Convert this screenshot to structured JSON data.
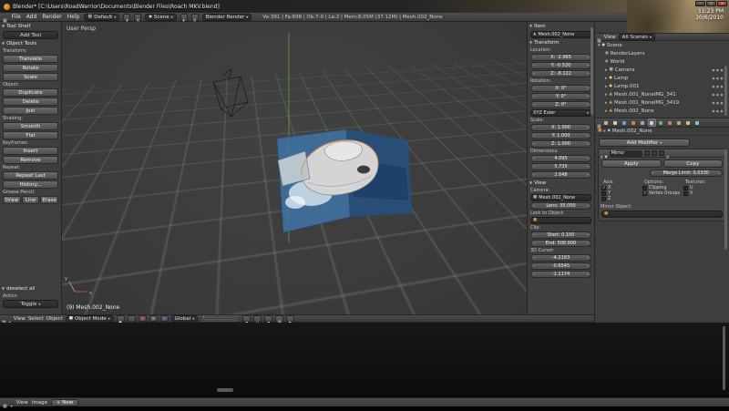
{
  "titlebar": {
    "title": "Blender* [C:\\Users\\RoadWarrior\\Documents\\Blender Files\\Roach MKV.blend]",
    "clock_time": "11:23 PM",
    "clock_date": "10/6/2010",
    "buttons": {
      "minimize": "–",
      "maximize": "□",
      "close": "×"
    }
  },
  "infobar": {
    "menus": [
      "File",
      "Add",
      "Render",
      "Help"
    ],
    "layout_value": "Default",
    "scene_value": "Scene",
    "engine_value": "Blender Render",
    "stats": "Ve:391 | Fa:698 | Ob:7-0 | La:2 | Mem:8.05M (37.12M) | Mesh.002_None"
  },
  "tool_shelf": {
    "title": "Tool Shelf",
    "add_tool_label": "Add Tool",
    "panel_title": "Object Tools",
    "groups": [
      {
        "label": "Transform:",
        "buttons": [
          "Translate",
          "Rotate",
          "Scale"
        ]
      },
      {
        "label": "Object:",
        "buttons": [
          "Duplicate",
          "Delete",
          "Join"
        ]
      },
      {
        "label": "Shading:",
        "buttons": [
          "Smooth",
          "Flat"
        ]
      },
      {
        "label": "Keyframes:",
        "buttons": [
          "Insert",
          "Remove"
        ]
      },
      {
        "label": "Repeat:",
        "buttons": [
          "Repeat Last",
          "History..."
        ]
      },
      {
        "label": "Grease Pencil:",
        "buttons": [
          "Draw",
          "Line",
          "Erase"
        ]
      }
    ],
    "operator_panel": "deselect all",
    "action_label": "Action",
    "action_value": "Toggle"
  },
  "viewport": {
    "view_label": "User Persp",
    "object_label": "(9) Mesh.002_None",
    "axis_x": "x",
    "axis_y": "y"
  },
  "n_panel": {
    "item_header": "Item",
    "item_name": "Mesh.002_None",
    "transform_header": "Transform",
    "location_label": "Location:",
    "location_x": "X: -2.965",
    "location_y": "Y: -0.520",
    "location_z": "Z: -8.122",
    "rotation_label": "Rotation:",
    "rotation_x": "X: 0°",
    "rotation_y": "Y: 0°",
    "rotation_z": "Z: 0°",
    "rotation_mode": "XYZ Euler",
    "scale_label": "Scale:",
    "scale_x": "X: 1.000",
    "scale_y": "Y: 1.000",
    "scale_z": "Z: 1.000",
    "dimensions_label": "Dimensions:",
    "dim_x": "4.095",
    "dim_y": "5.735",
    "dim_z": "2.048",
    "view_header": "View",
    "camera_label": "Camera:",
    "camera_value": "Mesh.002_None",
    "lens_value": "Lens: 35.000",
    "lock_label": "Lock to Object:",
    "clip_label": "Clip:",
    "clip_start": "Start: 0.100",
    "clip_end": "End: 500.000",
    "cursor_label": "3D Cursor:",
    "cursor_x": "-4.2193",
    "cursor_y": "-0.6545",
    "cursor_z": "-1.1174"
  },
  "outliner": {
    "view_menu": "View",
    "scenes_filter": "All Scenes",
    "rows": [
      {
        "label": "Scene",
        "icon": "scene-icon"
      },
      {
        "label": "RenderLayers",
        "icon": "renderlayers-icon"
      },
      {
        "label": "World",
        "icon": "world-icon"
      },
      {
        "label": "Camera",
        "icon": "camera-icon"
      },
      {
        "label": "Lamp",
        "icon": "lamp-icon"
      },
      {
        "label": "Lamp.001",
        "icon": "lamp-icon"
      },
      {
        "label": "Mesh.001_NoneIMG_341",
        "icon": "mesh-icon"
      },
      {
        "label": "Mesh.001_NoneIMG_3419",
        "icon": "mesh-icon"
      },
      {
        "label": "Mesh.002_None",
        "icon": "mesh-icon"
      }
    ]
  },
  "properties": {
    "tabs": [
      "render",
      "scene",
      "world",
      "object",
      "constraints",
      "modifiers",
      "data",
      "material",
      "texture",
      "particles",
      "physics"
    ],
    "breadcrumb": "Mesh.002_None",
    "add_modifier_label": "Add Modifier",
    "modifier": {
      "name": "Mirror",
      "apply_label": "Apply",
      "copy_label": "Copy",
      "merge_limit": "Merge Limit: 0.0330",
      "axis_label": "Axis:",
      "axis": [
        {
          "label": "X",
          "check": "✓"
        },
        {
          "label": "Y",
          "check": ""
        },
        {
          "label": "Z",
          "check": ""
        }
      ],
      "options_label": "Options:",
      "options": [
        {
          "label": "Clipping",
          "check": ""
        },
        {
          "label": "Vertex Groups",
          "check": "✓"
        }
      ],
      "textures_label": "Textures:",
      "textures": [
        {
          "label": "U",
          "check": ""
        },
        {
          "label": "V",
          "check": ""
        }
      ],
      "mirror_object_label": "Mirror Object:"
    }
  },
  "viewport_header": {
    "menus": [
      "View",
      "Select",
      "Object"
    ],
    "mode_value": "Object Mode",
    "orientation_value": "Global"
  },
  "image_editor_header": {
    "menus": [
      "View",
      "Image"
    ],
    "new_button": "New"
  }
}
